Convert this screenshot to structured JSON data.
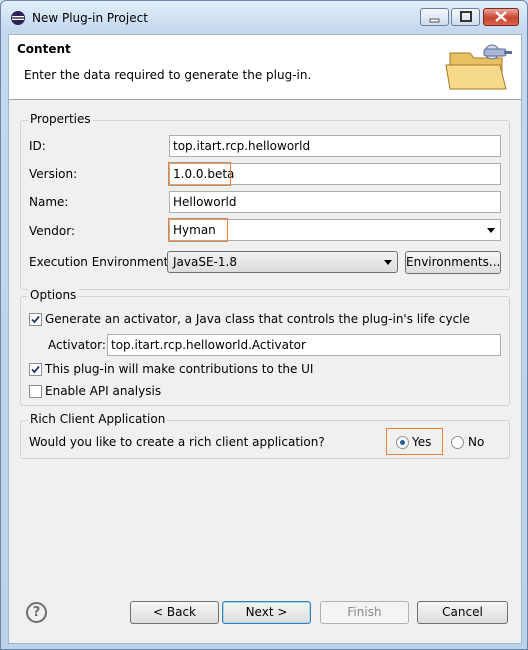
{
  "window": {
    "title": "New Plug-in Project"
  },
  "header": {
    "title": "Content",
    "description": "Enter the data required to generate the plug-in."
  },
  "properties": {
    "group_label": "Properties",
    "id_label": "ID:",
    "id_value": "top.itart.rcp.helloworld",
    "version_label": "Version:",
    "version_value": "1.0.0.beta",
    "name_label": "Name:",
    "name_value": "Helloworld",
    "vendor_label": "Vendor:",
    "vendor_value": "Hyman",
    "env_label": "Execution Environment:",
    "env_value": "JavaSE-1.8",
    "env_button": "Environments..."
  },
  "options": {
    "group_label": "Options",
    "generate_activator_label": "Generate an activator, a Java class that controls the plug-in's life cycle",
    "generate_activator_checked": true,
    "activator_label": "Activator:",
    "activator_value": "top.itart.rcp.helloworld.Activator",
    "ui_contrib_label": "This plug-in will make contributions to the UI",
    "ui_contrib_checked": true,
    "api_analysis_label": "Enable API analysis",
    "api_analysis_checked": false
  },
  "rca": {
    "group_label": "Rich Client Application",
    "question": "Would you like to create a rich client application?",
    "yes_label": "Yes",
    "no_label": "No",
    "selected": "Yes"
  },
  "footer": {
    "help_glyph": "?",
    "back_label": "< Back",
    "next_label": "Next >",
    "finish_label": "Finish",
    "cancel_label": "Cancel"
  },
  "colors": {
    "highlight": "#e8823a",
    "accent": "#1f5ea8"
  }
}
